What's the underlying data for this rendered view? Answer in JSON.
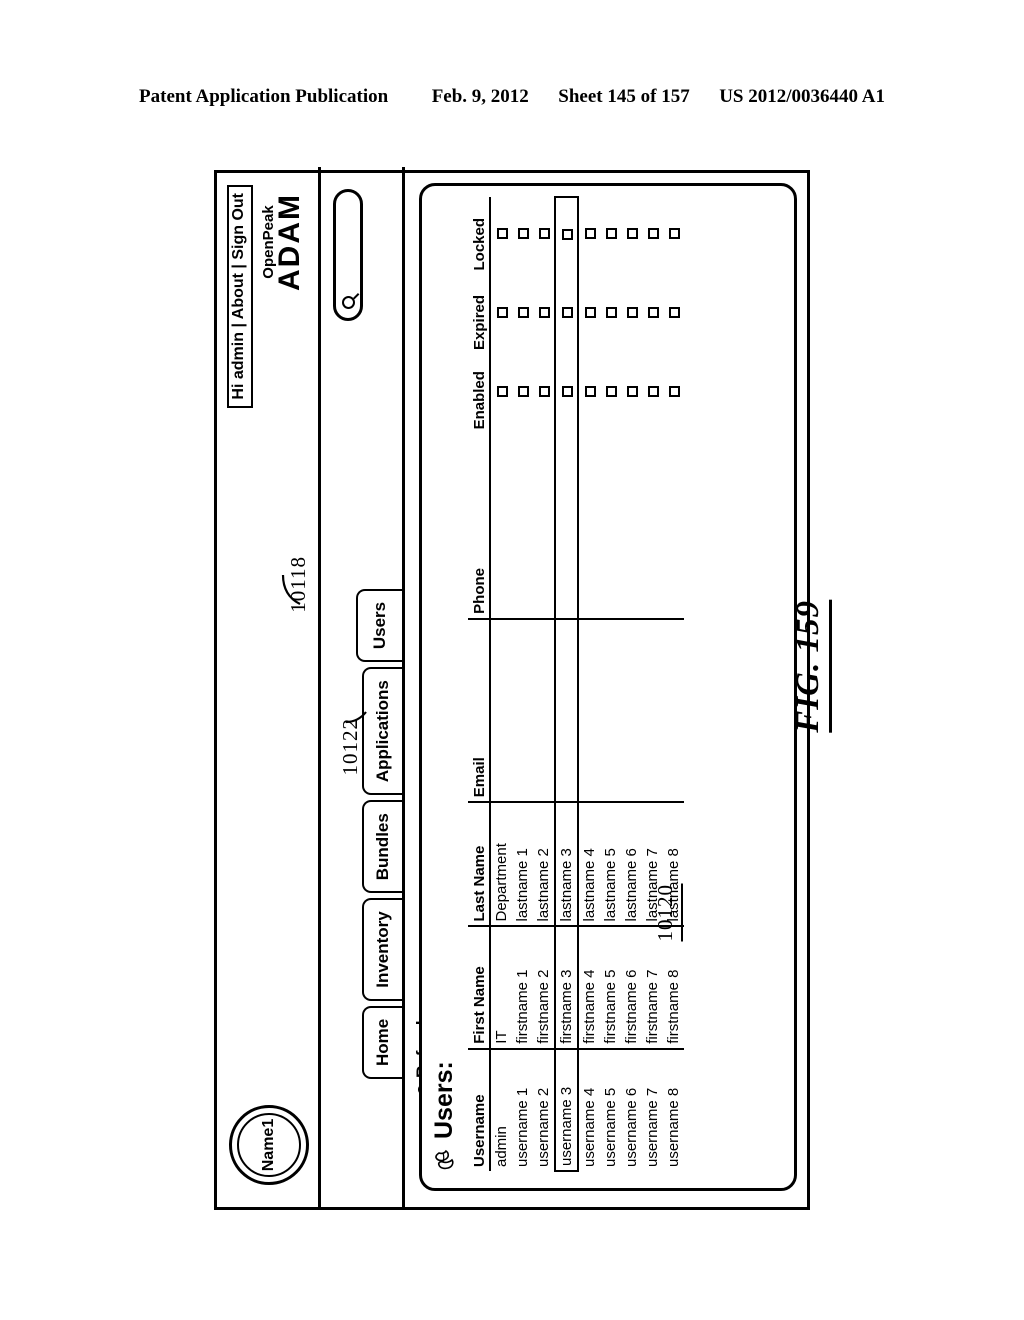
{
  "patent_header": {
    "publication": "Patent Application Publication",
    "date": "Feb. 9, 2012",
    "sheet": "Sheet 145 of 157",
    "number": "US 2012/0036440 A1"
  },
  "figure": {
    "label": "FIG. 159",
    "reference_numerals": [
      {
        "id": "10118",
        "target": "users-tab"
      },
      {
        "id": "10122",
        "target": "email-column"
      },
      {
        "id": "10120",
        "target": "users-table"
      }
    ]
  },
  "app": {
    "logo_badge": "Name1",
    "account_links": "Hi admin | About | Sign Out",
    "brand_sub": "OpenPeak",
    "brand_main": "ADAM",
    "refresh_label": "Refresh",
    "search_placeholder": "",
    "search_value": "",
    "tabs": [
      {
        "label": "Home",
        "active": false
      },
      {
        "label": "Inventory",
        "active": false
      },
      {
        "label": "Bundles",
        "active": false
      },
      {
        "label": "Applications",
        "active": false
      },
      {
        "label": "Users",
        "active": true
      }
    ]
  },
  "panel": {
    "title": "Users:",
    "table": {
      "columns": [
        "Username",
        "First Name",
        "Last Name",
        "Email",
        "Phone",
        "Enabled",
        "Expired",
        "Locked"
      ],
      "rows": [
        {
          "username": "admin",
          "first_name": "IT",
          "last_name": "Department",
          "email": "",
          "phone": "",
          "enabled": false,
          "expired": false,
          "locked": false,
          "selected": false
        },
        {
          "username": "username 1",
          "first_name": "firstname 1",
          "last_name": "lastname 1",
          "email": "",
          "phone": "",
          "enabled": false,
          "expired": false,
          "locked": false,
          "selected": false
        },
        {
          "username": "username 2",
          "first_name": "firstname 2",
          "last_name": "lastname 2",
          "email": "",
          "phone": "",
          "enabled": false,
          "expired": false,
          "locked": false,
          "selected": false
        },
        {
          "username": "username 3",
          "first_name": "firstname 3",
          "last_name": "lastname 3",
          "email": "",
          "phone": "",
          "enabled": false,
          "expired": false,
          "locked": false,
          "selected": true
        },
        {
          "username": "username 4",
          "first_name": "firstname 4",
          "last_name": "lastname 4",
          "email": "",
          "phone": "",
          "enabled": false,
          "expired": false,
          "locked": false,
          "selected": false
        },
        {
          "username": "username 5",
          "first_name": "firstname 5",
          "last_name": "lastname 5",
          "email": "",
          "phone": "",
          "enabled": false,
          "expired": false,
          "locked": false,
          "selected": false
        },
        {
          "username": "username 6",
          "first_name": "firstname 6",
          "last_name": "lastname 6",
          "email": "",
          "phone": "",
          "enabled": false,
          "expired": false,
          "locked": false,
          "selected": false
        },
        {
          "username": "username 7",
          "first_name": "firstname 7",
          "last_name": "lastname 7",
          "email": "",
          "phone": "",
          "enabled": false,
          "expired": false,
          "locked": false,
          "selected": false
        },
        {
          "username": "username 8",
          "first_name": "firstname 8",
          "last_name": "lastname 8",
          "email": "",
          "phone": "",
          "enabled": false,
          "expired": false,
          "locked": false,
          "selected": false
        }
      ]
    }
  },
  "icons": {
    "search": "search-icon",
    "refresh": "refresh-icon",
    "users": "users-icon"
  },
  "colors": {
    "ink": "#000000",
    "paper": "#ffffff"
  }
}
